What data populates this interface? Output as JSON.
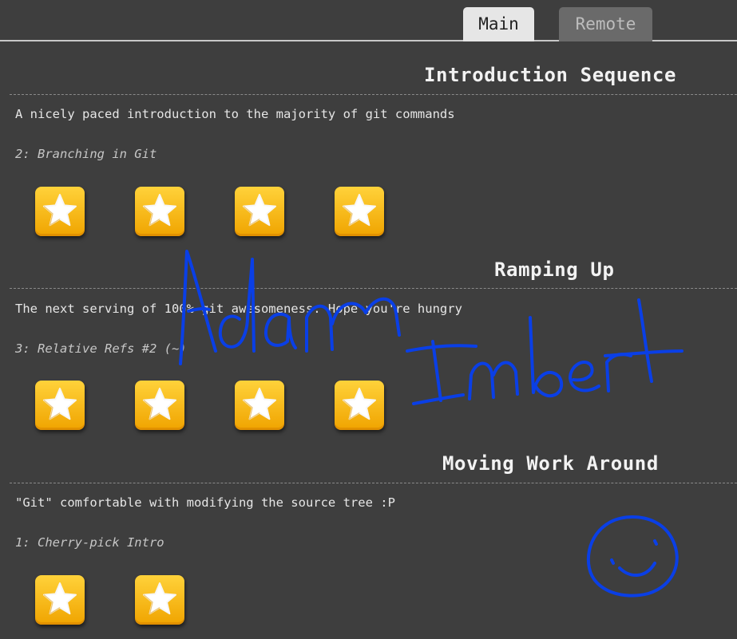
{
  "tabs": {
    "main_label": "Main",
    "remote_label": "Remote"
  },
  "sequences": [
    {
      "title": "Introduction Sequence",
      "about": "A nicely paced introduction to the majority of git commands",
      "current_level": "2: Branching in Git",
      "level_count": 4
    },
    {
      "title": "Ramping Up",
      "about": "The next serving of 100% git awesomeness. Hope you're hungry",
      "current_level": "3: Relative Refs #2 (~)",
      "level_count": 4
    },
    {
      "title": "Moving Work Around",
      "about": "\"Git\" comfortable with modifying the source tree :P",
      "current_level": "1: Cherry-pick Intro",
      "level_count": 2
    }
  ],
  "level_icon": "star-icon",
  "annotation": {
    "handwriting": "Adam Imbert",
    "drawing": "smiley-face",
    "ink_color": "#0a3fe6"
  },
  "colors": {
    "background": "#3e3e3e",
    "star_button": "#fcbe12"
  }
}
